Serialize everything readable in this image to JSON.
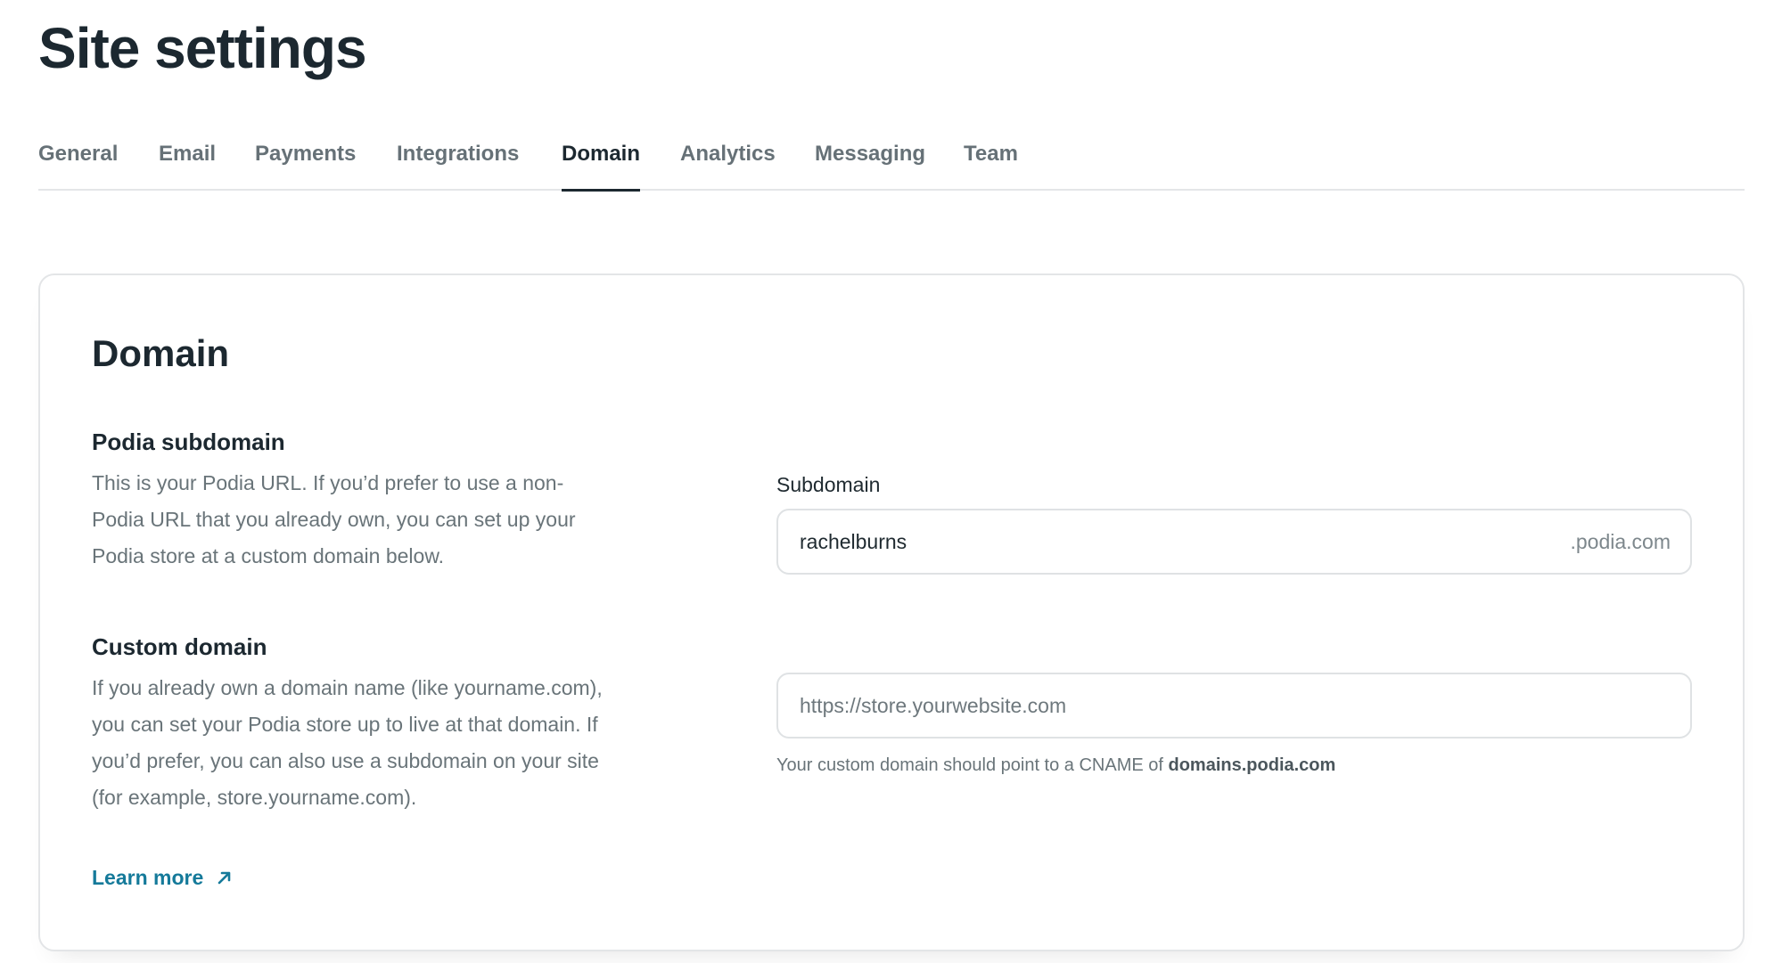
{
  "page": {
    "title": "Site settings"
  },
  "tabs": [
    {
      "label": "General"
    },
    {
      "label": "Email"
    },
    {
      "label": "Payments"
    },
    {
      "label": "Integrations"
    },
    {
      "label": "Domain"
    },
    {
      "label": "Analytics"
    },
    {
      "label": "Messaging"
    },
    {
      "label": "Team"
    }
  ],
  "active_tab": "Domain",
  "card": {
    "title": "Domain",
    "subdomain_section": {
      "title": "Podia subdomain",
      "description": "This is your Podia URL. If you’d prefer to use a non-Podia URL that you already own, you can set up your Podia store at a custom domain below.",
      "field_label": "Subdomain",
      "value": "rachelburns",
      "suffix": ".podia.com"
    },
    "custom_section": {
      "title": "Custom domain",
      "description": "If you already own a domain name (like yourname.com), you can set your Podia store up to live at that domain. If you’d prefer, you can also use a subdomain on your site (for example, store.yourname.com).",
      "placeholder": "https://store.yourwebsite.com",
      "hint_prefix": "Your custom domain should point to a CNAME of ",
      "hint_domain": "domains.podia.com",
      "learn_more": "Learn more"
    }
  },
  "colors": {
    "link": "#157a9a",
    "text": "#1c2830",
    "muted": "#697479"
  },
  "icons": {
    "learn_more": "arrow-up-right-icon"
  }
}
